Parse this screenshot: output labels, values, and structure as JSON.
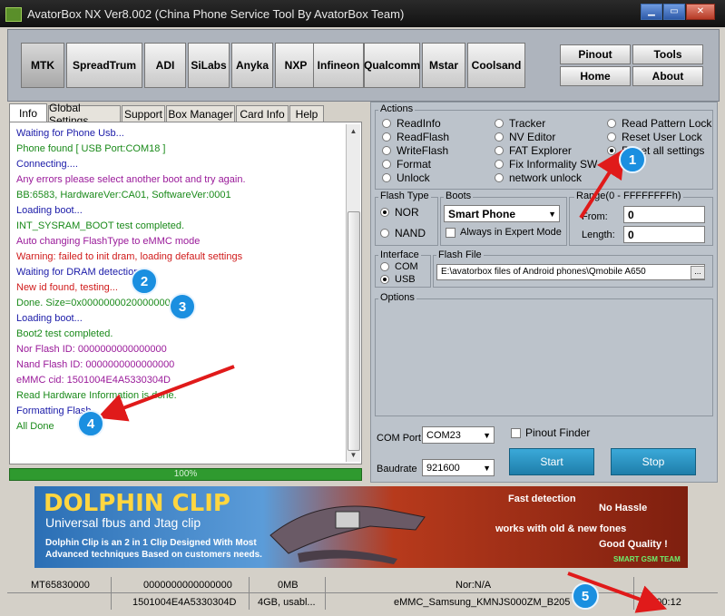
{
  "window": {
    "title": "AvatorBox NX Ver8.002 (China Phone Service Tool By AvatorBox Team)"
  },
  "chipsets": [
    "MTK",
    "SpreadTrum",
    "ADI",
    "SiLabs",
    "Anyka",
    "NXP",
    "Infineon",
    "Qualcomm",
    "Mstar",
    "Coolsand"
  ],
  "nav": {
    "pinout": "Pinout",
    "tools": "Tools",
    "home": "Home",
    "about": "About"
  },
  "tabs": [
    "Info",
    "Global Settings",
    "Support",
    "Box Manager",
    "Card Info",
    "Help"
  ],
  "log": [
    {
      "text": "Waiting for Phone Usb...",
      "color": "#1a1aa8"
    },
    {
      "text": "Phone found [ USB Port:COM18 ]",
      "color": "#1a8a1a"
    },
    {
      "text": "Connecting....",
      "color": "#1a1aa8"
    },
    {
      "text": "Any errors please select another boot and try again.",
      "color": "#9a1a9a"
    },
    {
      "text": "BB:6583,   HardwareVer:CA01,   SoftwareVer:0001",
      "color": "#1a8a1a"
    },
    {
      "text": "Loading boot...",
      "color": "#1a1aa8"
    },
    {
      "text": "INT_SYSRAM_BOOT test completed.",
      "color": "#1a8a1a"
    },
    {
      "text": "Auto changing FlashType to eMMC mode",
      "color": "#9a1a9a"
    },
    {
      "text": "Warning: failed to init dram, loading default settings",
      "color": "#d01a1a"
    },
    {
      "text": "Waiting for DRAM detection",
      "color": "#1a1aa8"
    },
    {
      "text": "New id found, testing...",
      "color": "#d01a1a"
    },
    {
      "text": "Done. Size=0x0000000020000000",
      "color": "#1a8a1a"
    },
    {
      "text": "Loading boot...",
      "color": "#1a1aa8"
    },
    {
      "text": "Boot2 test completed.",
      "color": "#1a8a1a"
    },
    {
      "text": "Nor Flash ID: 0000000000000000",
      "color": "#9a1a9a"
    },
    {
      "text": "Nand Flash ID: 0000000000000000",
      "color": "#9a1a9a"
    },
    {
      "text": "eMMC cid: 1501004E4A5330304D",
      "color": "#9a1a9a"
    },
    {
      "text": "Read Hardware Information is done.",
      "color": "#1a8a1a"
    },
    {
      "text": "Formatting Flash...",
      "color": "#1a1aa8"
    },
    {
      "text": "All Done",
      "color": "#1a8a1a"
    }
  ],
  "progress": {
    "value": 100,
    "label": "100%"
  },
  "actions": {
    "label": "Actions",
    "items": [
      {
        "label": "ReadInfo",
        "checked": false
      },
      {
        "label": "ReadFlash",
        "checked": false
      },
      {
        "label": "WriteFlash",
        "checked": false
      },
      {
        "label": "Format",
        "checked": false
      },
      {
        "label": "Unlock",
        "checked": false
      },
      {
        "label": "Tracker",
        "checked": false
      },
      {
        "label": "NV Editor",
        "checked": false
      },
      {
        "label": "FAT Explorer",
        "checked": false
      },
      {
        "label": "Fix Informality SW",
        "checked": false
      },
      {
        "label": "network unlock",
        "checked": false
      },
      {
        "label": "Read Pattern Lock",
        "checked": false
      },
      {
        "label": "Reset User Lock",
        "checked": false
      },
      {
        "label": "Reset all settings",
        "checked": true
      }
    ]
  },
  "flash_type": {
    "label": "Flash Type",
    "nor": "NOR",
    "nand": "NAND",
    "selected": "NOR"
  },
  "boots": {
    "label": "Boots",
    "value": "Smart Phone",
    "expert_label": "Always in Expert Mode"
  },
  "range": {
    "label": "Range(0 - FFFFFFFFh)",
    "from_label": "From:",
    "from_value": "0",
    "length_label": "Length:",
    "length_value": "0"
  },
  "interface": {
    "label": "Interface",
    "com": "COM",
    "usb": "USB",
    "selected": "USB"
  },
  "flash_file": {
    "label": "Flash File",
    "value": "E:\\avatorbox files of Android phones\\Qmobile A650",
    "browse": "..."
  },
  "options": {
    "label": "Options"
  },
  "com_port": {
    "label": "COM Port",
    "value": "COM23"
  },
  "baudrate": {
    "label": "Baudrate",
    "value": "921600"
  },
  "pinout_finder": "Pinout Finder",
  "start": "Start",
  "stop": "Stop",
  "banner": {
    "title": "DOLPHIN CLIP",
    "subtitle": "Universal fbus and Jtag clip",
    "desc": "Dolphin Clip is an 2 in 1 Clip Designed With Most Advanced techniques Based on customers needs.",
    "fast": "Fast detection",
    "hassle": "No Hassle",
    "works": "works with old & new fones",
    "quality": "Good Quality !",
    "team": "SMART GSM TEAM"
  },
  "status": {
    "row1": [
      "MT65830000",
      "0000000000000000",
      "0MB",
      "Nor:N/A"
    ],
    "row2": [
      "1501004E4A5330304D",
      "4GB, usabl...",
      "eMMC_Samsung_KMNJS000ZM_B205",
      "00:00:12"
    ]
  },
  "markers": [
    "1",
    "2",
    "3",
    "4",
    "5"
  ]
}
